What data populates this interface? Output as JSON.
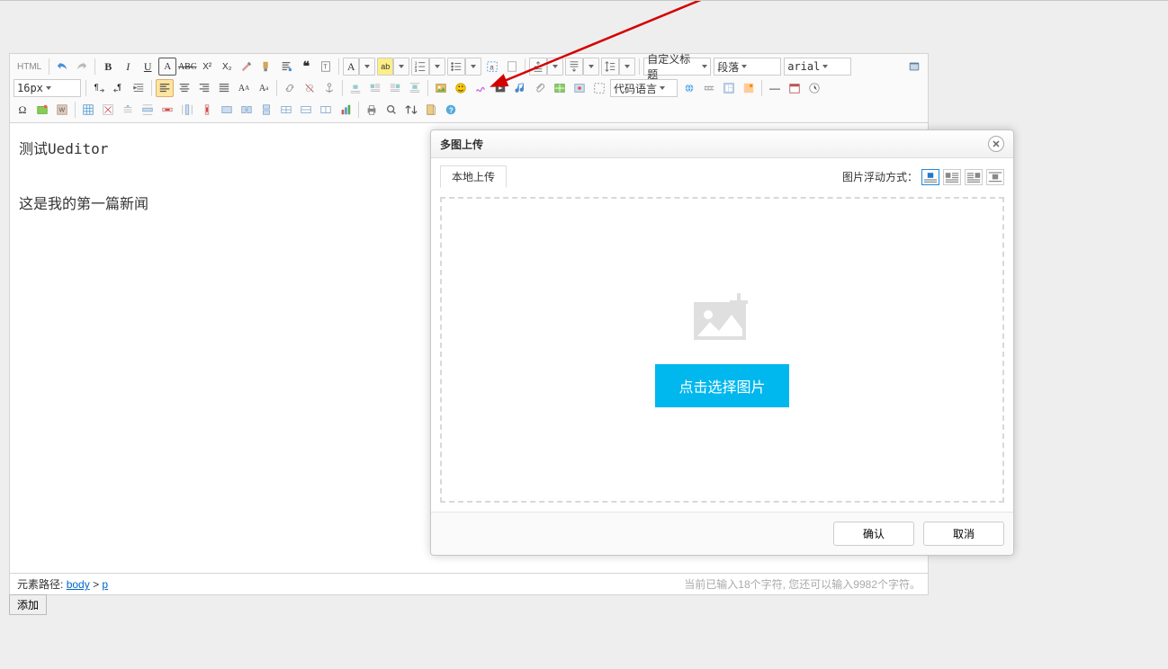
{
  "toolbar": {
    "source_label": "HTML",
    "font_size": "16px",
    "custom_title": "自定义标题",
    "paragraph": "段落",
    "font_family": "arial",
    "code_lang": "代码语言"
  },
  "content": {
    "line1": "测试Ueditor",
    "line2": "这是我的第一篇新闻"
  },
  "footer": {
    "path_label": "元素路径:",
    "path1": "body",
    "sep": ">",
    "path2": "p",
    "count": "当前已输入18个字符, 您还可以输入9982个字符。"
  },
  "add_button": "添加",
  "dialog": {
    "title": "多图上传",
    "tab_local": "本地上传",
    "float_label": "图片浮动方式：",
    "select_btn": "点击选择图片",
    "ok": "确认",
    "cancel": "取消"
  }
}
